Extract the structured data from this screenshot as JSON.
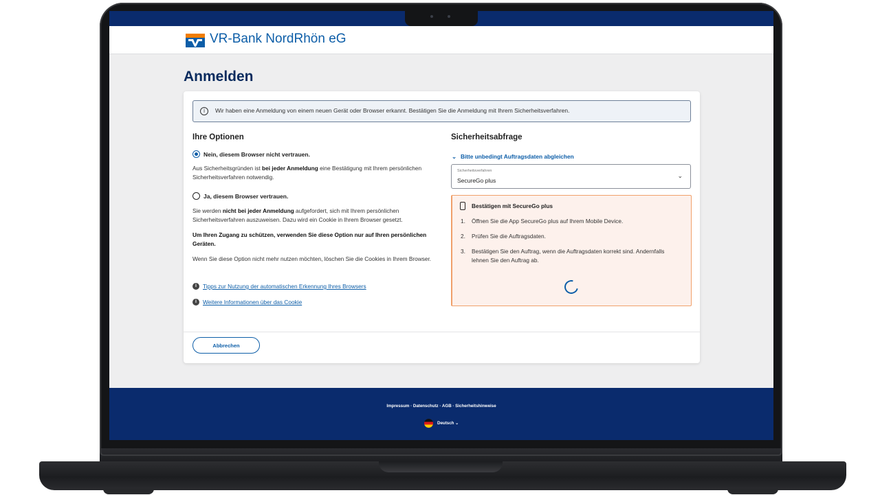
{
  "bank": {
    "name": "VR-Bank NordRhön eG"
  },
  "page": {
    "title": "Anmelden"
  },
  "info": {
    "text": "Wir haben eine Anmeldung von einem neuen Gerät oder Browser erkannt. Bestätigen Sie die Anmeldung mit Ihrem Sicherheitsverfahren."
  },
  "options": {
    "heading": "Ihre Optionen",
    "option1": {
      "label": "Nein, diesem Browser nicht vertrauen.",
      "selected": true,
      "text_a": "Aus Sicherheitsgründen ist ",
      "text_b": "bei jeder Anmeldung",
      "text_c": " eine Bestätigung mit Ihrem persönlichen Sicherheitsverfahren notwendig."
    },
    "option2": {
      "label": "Ja, diesem Browser vertrauen.",
      "selected": false,
      "text_a": "Sie werden ",
      "text_b": "nicht bei jeder Anmeldung",
      "text_c": " aufgefordert, sich mit Ihrem persönlichen Sicherheitsverfahren auszuweisen. Dazu wird ein Cookie in Ihrem Browser gesetzt.",
      "warning": "Um Ihren Zugang zu schützen, verwenden Sie diese Option nur auf Ihren persönlichen Geräten.",
      "note": "Wenn Sie diese Option nicht mehr nutzen möchten, löschen Sie die Cookies in Ihrem Browser."
    },
    "link1": "Tipps zur Nutzung der automatischen Erkennung Ihres Browsers",
    "link2": "Weitere Informationen über das Cookie"
  },
  "security": {
    "heading": "Sicherheitsabfrage",
    "collapse_label": "Bitte unbedingt Auftragsdaten abgleichen",
    "select_label": "Sicherheitsverfahren",
    "select_value": "SecureGo plus",
    "box_title": "Bestätigen mit SecureGo plus",
    "steps": [
      {
        "n": "1.",
        "text": "Öffnen Sie die App SecureGo plus auf Ihrem Mobile Device."
      },
      {
        "n": "2.",
        "text": "Prüfen Sie die Auftragsdaten."
      },
      {
        "n": "3.",
        "text": "Bestätigen Sie den Auftrag, wenn die Auftragsdaten korrekt sind. Andernfalls lehnen Sie den Auftrag ab."
      }
    ]
  },
  "actions": {
    "cancel": "Abbrechen"
  },
  "footer": {
    "links": "Impressum · Datenschutz · AGB · Sicherheitshinweise",
    "language": "Deutsch"
  },
  "colors": {
    "primary": "#0a2b6d",
    "accent": "#0d5ea8",
    "warning_border": "#f0a06a",
    "warning_bg": "#fdf1ec"
  }
}
